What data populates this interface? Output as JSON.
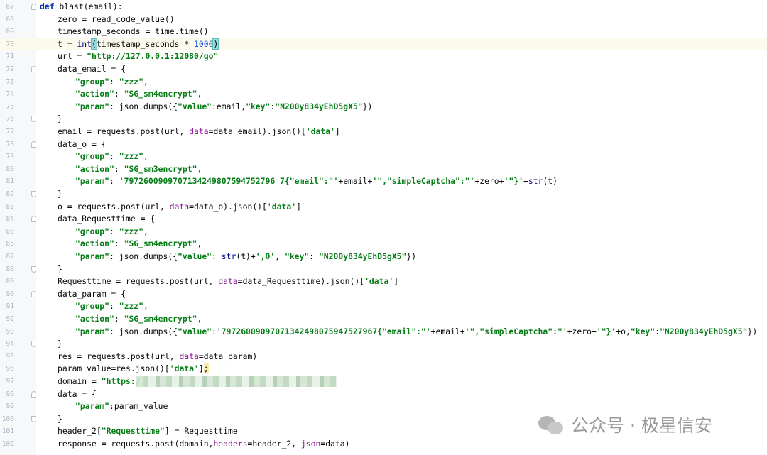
{
  "editor": {
    "lines": [
      {
        "n": "67",
        "indent": 0,
        "fold": "start",
        "tokens": [
          [
            "kw",
            "def"
          ],
          [
            "t",
            " blast(email):"
          ]
        ]
      },
      {
        "n": "68",
        "indent": 1,
        "tokens": [
          [
            "t",
            "zero = read_code_value()"
          ]
        ]
      },
      {
        "n": "69",
        "indent": 1,
        "tokens": [
          [
            "t",
            "timestamp_seconds = time.time()"
          ]
        ]
      },
      {
        "n": "70",
        "indent": 1,
        "current": true,
        "tokens": [
          [
            "t",
            "t = "
          ],
          [
            "builtin",
            "int"
          ],
          [
            "hl",
            "("
          ],
          [
            "t",
            "timestamp_seconds * "
          ],
          [
            "num",
            "1000"
          ],
          [
            "hl",
            ")"
          ],
          [
            "caret",
            ""
          ]
        ]
      },
      {
        "n": "71",
        "indent": 1,
        "tokens": [
          [
            "t",
            "url = "
          ],
          [
            "str",
            "\""
          ],
          [
            "url",
            "http://127.0.0.1:12080/go"
          ],
          [
            "str",
            "\""
          ]
        ]
      },
      {
        "n": "72",
        "indent": 1,
        "fold": "start",
        "tokens": [
          [
            "t",
            "data_email = {"
          ]
        ]
      },
      {
        "n": "73",
        "indent": 2,
        "tokens": [
          [
            "str",
            "\"group\""
          ],
          [
            "t",
            ": "
          ],
          [
            "str",
            "\"zzz\""
          ],
          [
            "t",
            ","
          ]
        ]
      },
      {
        "n": "74",
        "indent": 2,
        "tokens": [
          [
            "str",
            "\"action\""
          ],
          [
            "t",
            ": "
          ],
          [
            "str",
            "\"SG_sm4encrypt\""
          ],
          [
            "t",
            ","
          ]
        ]
      },
      {
        "n": "75",
        "indent": 2,
        "tokens": [
          [
            "str",
            "\"param\""
          ],
          [
            "t",
            ": json.dumps({"
          ],
          [
            "str",
            "\"value\""
          ],
          [
            "t",
            ":email,"
          ],
          [
            "str",
            "\"key\""
          ],
          [
            "t",
            ":"
          ],
          [
            "str",
            "\"N200y834yEhD5gX5\""
          ],
          [
            "t",
            "})"
          ]
        ]
      },
      {
        "n": "76",
        "indent": 1,
        "fold": "end",
        "tokens": [
          [
            "t",
            "}"
          ]
        ]
      },
      {
        "n": "77",
        "indent": 1,
        "tokens": [
          [
            "t",
            "email = requests.post(url, "
          ],
          [
            "param",
            "data"
          ],
          [
            "t",
            "=data_email).json()["
          ],
          [
            "str",
            "'data'"
          ],
          [
            "t",
            "]"
          ]
        ]
      },
      {
        "n": "78",
        "indent": 1,
        "fold": "start",
        "tokens": [
          [
            "t",
            "data_o = {"
          ]
        ]
      },
      {
        "n": "79",
        "indent": 2,
        "tokens": [
          [
            "str",
            "\"group\""
          ],
          [
            "t",
            ": "
          ],
          [
            "str",
            "\"zzz\""
          ],
          [
            "t",
            ","
          ]
        ]
      },
      {
        "n": "80",
        "indent": 2,
        "tokens": [
          [
            "str",
            "\"action\""
          ],
          [
            "t",
            ": "
          ],
          [
            "str",
            "\"SG_sm3encrypt\""
          ],
          [
            "t",
            ","
          ]
        ]
      },
      {
        "n": "81",
        "indent": 2,
        "tokens": [
          [
            "str",
            "\"param\""
          ],
          [
            "t",
            ": "
          ],
          [
            "str",
            "'7972600909707134249807594752796 7{\"email\":\"'"
          ],
          [
            "t",
            "+email+"
          ],
          [
            "str",
            "'\",\"simpleCaptcha\":\"'"
          ],
          [
            "t",
            "+zero+"
          ],
          [
            "str",
            "'\"}'"
          ],
          [
            "t",
            "+"
          ],
          [
            "builtin",
            "str"
          ],
          [
            "t",
            "(t)"
          ]
        ]
      },
      {
        "n": "82",
        "indent": 1,
        "fold": "end",
        "tokens": [
          [
            "t",
            "}"
          ]
        ]
      },
      {
        "n": "83",
        "indent": 1,
        "tokens": [
          [
            "t",
            "o = requests.post(url, "
          ],
          [
            "param",
            "data"
          ],
          [
            "t",
            "=data_o).json()["
          ],
          [
            "str",
            "'data'"
          ],
          [
            "t",
            "]"
          ]
        ]
      },
      {
        "n": "84",
        "indent": 1,
        "fold": "start",
        "tokens": [
          [
            "t",
            "data_Requesttime = {"
          ]
        ]
      },
      {
        "n": "85",
        "indent": 2,
        "tokens": [
          [
            "str",
            "\"group\""
          ],
          [
            "t",
            ": "
          ],
          [
            "str",
            "\"zzz\""
          ],
          [
            "t",
            ","
          ]
        ]
      },
      {
        "n": "86",
        "indent": 2,
        "tokens": [
          [
            "str",
            "\"action\""
          ],
          [
            "t",
            ": "
          ],
          [
            "str",
            "\"SG_sm4encrypt\""
          ],
          [
            "t",
            ","
          ]
        ]
      },
      {
        "n": "87",
        "indent": 2,
        "tokens": [
          [
            "str",
            "\"param\""
          ],
          [
            "t",
            ": json.dumps({"
          ],
          [
            "str",
            "\"value\""
          ],
          [
            "t",
            ": "
          ],
          [
            "builtin",
            "str"
          ],
          [
            "t",
            "(t)+"
          ],
          [
            "str",
            "',0'"
          ],
          [
            "t",
            ", "
          ],
          [
            "str",
            "\"key\""
          ],
          [
            "t",
            ": "
          ],
          [
            "str",
            "\"N200y834yEhD5gX5\""
          ],
          [
            "t",
            "})"
          ]
        ]
      },
      {
        "n": "88",
        "indent": 1,
        "fold": "end",
        "tokens": [
          [
            "t",
            "}"
          ]
        ]
      },
      {
        "n": "89",
        "indent": 1,
        "tokens": [
          [
            "t",
            "Requesttime = requests.post(url, "
          ],
          [
            "param",
            "data"
          ],
          [
            "t",
            "=data_Requesttime).json()["
          ],
          [
            "str",
            "'data'"
          ],
          [
            "t",
            "]"
          ]
        ]
      },
      {
        "n": "90",
        "indent": 1,
        "fold": "start",
        "tokens": [
          [
            "t",
            "data_param = {"
          ]
        ]
      },
      {
        "n": "91",
        "indent": 2,
        "tokens": [
          [
            "str",
            "\"group\""
          ],
          [
            "t",
            ": "
          ],
          [
            "str",
            "\"zzz\""
          ],
          [
            "t",
            ","
          ]
        ]
      },
      {
        "n": "92",
        "indent": 2,
        "tokens": [
          [
            "str",
            "\"action\""
          ],
          [
            "t",
            ": "
          ],
          [
            "str",
            "\"SG_sm4encrypt\""
          ],
          [
            "t",
            ","
          ]
        ]
      },
      {
        "n": "93",
        "indent": 2,
        "tokens": [
          [
            "str",
            "\"param\""
          ],
          [
            "t",
            ": json.dumps({"
          ],
          [
            "str",
            "\"value\""
          ],
          [
            "t",
            ":"
          ],
          [
            "str",
            "'79726009097071342498075947527967{\"email\":\"'"
          ],
          [
            "t",
            "+email+"
          ],
          [
            "str",
            "'\",\"simpleCaptcha\":\"'"
          ],
          [
            "t",
            "+zero+"
          ],
          [
            "str",
            "'\"}'"
          ],
          [
            "t",
            "+o,"
          ],
          [
            "str",
            "\"key\""
          ],
          [
            "t",
            ":"
          ],
          [
            "str",
            "\"N200y834yEhD5gX5\""
          ],
          [
            "t",
            "})"
          ]
        ]
      },
      {
        "n": "94",
        "indent": 1,
        "fold": "end",
        "tokens": [
          [
            "t",
            "}"
          ]
        ]
      },
      {
        "n": "95",
        "indent": 1,
        "tokens": [
          [
            "t",
            "res = requests.post(url, "
          ],
          [
            "param",
            "data"
          ],
          [
            "t",
            "=data_param)"
          ]
        ]
      },
      {
        "n": "96",
        "indent": 1,
        "tokens": [
          [
            "t",
            "param_value=res.json()["
          ],
          [
            "str",
            "'data'"
          ],
          [
            "t",
            "]"
          ],
          [
            "warn",
            ";"
          ]
        ]
      },
      {
        "n": "97",
        "indent": 1,
        "blur": true,
        "tokens": [
          [
            "t",
            "domain = "
          ],
          [
            "str",
            "\""
          ],
          [
            "url",
            "https:/"
          ]
        ]
      },
      {
        "n": "98",
        "indent": 1,
        "fold": "start",
        "tokens": [
          [
            "t",
            "data = {"
          ]
        ]
      },
      {
        "n": "99",
        "indent": 2,
        "tokens": [
          [
            "str",
            "\"param\""
          ],
          [
            "t",
            ":param_value"
          ]
        ]
      },
      {
        "n": "100",
        "indent": 1,
        "fold": "end",
        "tokens": [
          [
            "t",
            "}"
          ]
        ]
      },
      {
        "n": "101",
        "indent": 1,
        "tokens": [
          [
            "t",
            "header_2["
          ],
          [
            "str",
            "\"Requesttime\""
          ],
          [
            "t",
            "] = Requesttime"
          ]
        ]
      },
      {
        "n": "102",
        "indent": 1,
        "tokens": [
          [
            "t",
            "response = requests.post(domain,"
          ],
          [
            "param",
            "headers"
          ],
          [
            "t",
            "=header_2, "
          ],
          [
            "param",
            "json"
          ],
          [
            "t",
            "=data)"
          ]
        ]
      }
    ]
  },
  "watermark": {
    "text": "公众号 · 极星信安",
    "icon": "wechat-icon"
  },
  "colors": {
    "keyword": "#0033b3",
    "string": "#067d17",
    "number": "#1750eb",
    "named_param": "#871094",
    "current_line": "#fcfaed"
  }
}
